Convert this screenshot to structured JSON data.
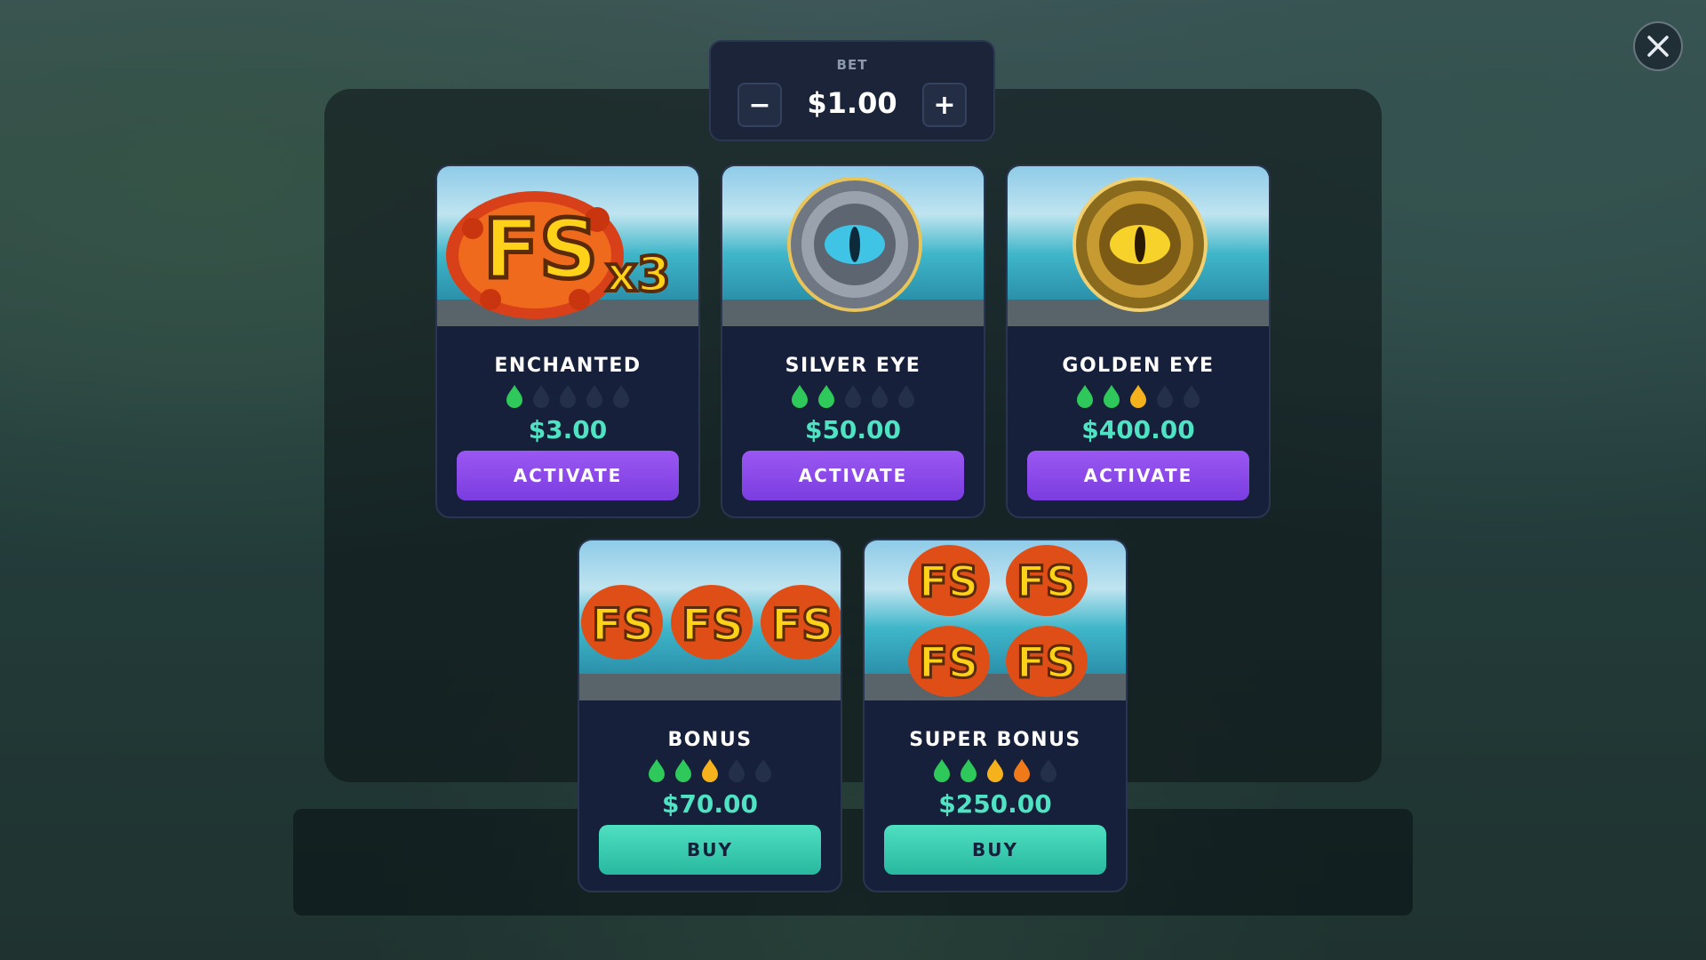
{
  "bet": {
    "label": "BET",
    "value": "$1.00",
    "minus_label": "−",
    "plus_label": "+"
  },
  "close_icon": "close-icon",
  "cards": [
    {
      "title": "ENCHANTED",
      "art": "fs-x3-badge",
      "volatility": 1,
      "volatility_max": 5,
      "price": "$3.00",
      "button": "ACTIVATE",
      "button_style": "purple"
    },
    {
      "title": "SILVER EYE",
      "art": "silver-eye-coin",
      "volatility": 2,
      "volatility_max": 5,
      "price": "$50.00",
      "button": "ACTIVATE",
      "button_style": "purple"
    },
    {
      "title": "GOLDEN EYE",
      "art": "golden-eye-coin",
      "volatility": 3,
      "volatility_max": 5,
      "price": "$400.00",
      "button": "ACTIVATE",
      "button_style": "purple"
    },
    {
      "title": "BONUS",
      "art": "three-fs-badges",
      "volatility": 3,
      "volatility_max": 5,
      "price": "$70.00",
      "button": "BUY",
      "button_style": "teal"
    },
    {
      "title": "SUPER BONUS",
      "art": "four-fs-badges",
      "volatility": 4,
      "volatility_max": 5,
      "price": "$250.00",
      "button": "BUY",
      "button_style": "teal"
    }
  ],
  "colors": {
    "price": "#4fe3c4",
    "activate_button": "#8a4aea",
    "buy_button": "#3cccb0",
    "drop_green": "#2fc85a",
    "drop_yellow": "#f5b21c",
    "drop_orange": "#f07a1a",
    "drop_empty": "#243049"
  }
}
